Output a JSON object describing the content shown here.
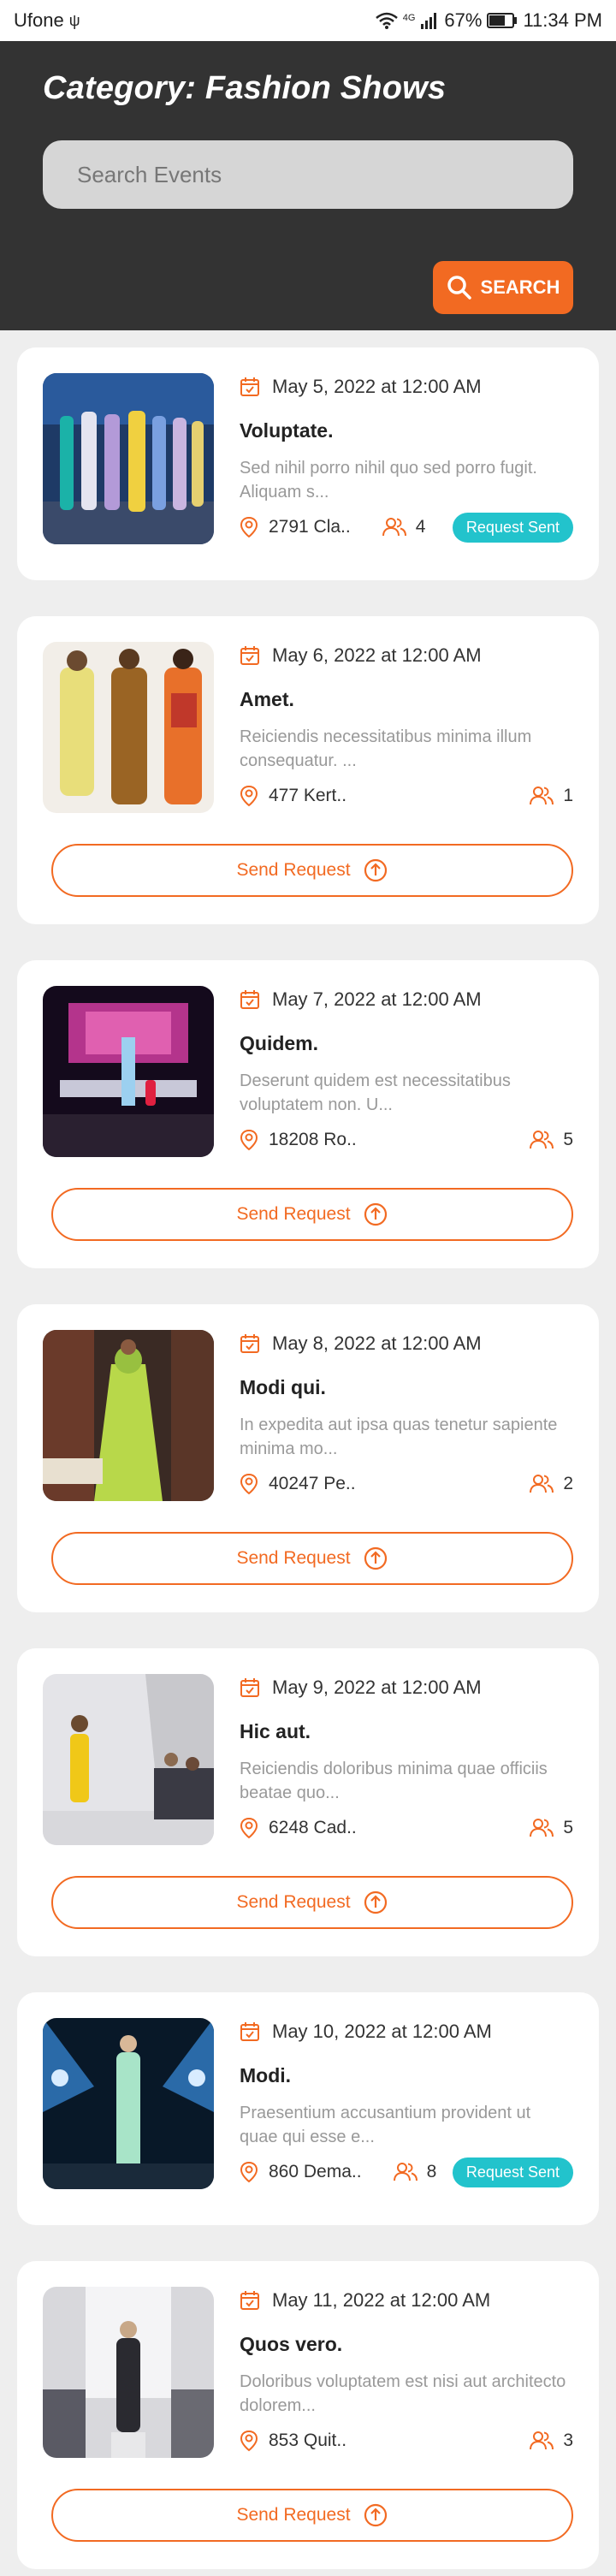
{
  "status_bar": {
    "carrier": "Ufone",
    "network": "4G",
    "battery": "67%",
    "time": "11:34 PM"
  },
  "header": {
    "title": "Category: Fashion Shows",
    "search_placeholder": "Search Events",
    "search_button": "SEARCH"
  },
  "colors": {
    "accent": "#f26a22",
    "header_bg": "#333333",
    "badge": "#22c3cc"
  },
  "events": [
    {
      "date": "May 5, 2022 at 12:00 AM",
      "title": "Voluptate.",
      "description": "Sed nihil porro nihil quo sed porro fugit. Aliquam s...",
      "location": "2791 Cla..",
      "attendees": "4",
      "status": "Request Sent",
      "action": ""
    },
    {
      "date": "May 6, 2022 at 12:00 AM",
      "title": "Amet.",
      "description": "Reiciendis necessitatibus minima illum consequatur. ...",
      "location": "477 Kert..",
      "attendees": "1",
      "status": "",
      "action": "Send Request"
    },
    {
      "date": "May 7, 2022 at 12:00 AM",
      "title": "Quidem.",
      "description": "Deserunt quidem est necessitatibus voluptatem non. U...",
      "location": "18208 Ro..",
      "attendees": "5",
      "status": "",
      "action": "Send Request"
    },
    {
      "date": "May 8, 2022 at 12:00 AM",
      "title": "Modi qui.",
      "description": "In expedita aut ipsa quas tenetur sapiente minima mo...",
      "location": "40247 Pe..",
      "attendees": "2",
      "status": "",
      "action": "Send Request"
    },
    {
      "date": "May 9, 2022 at 12:00 AM",
      "title": "Hic aut.",
      "description": "Reiciendis doloribus minima quae officiis beatae quo...",
      "location": "6248 Cad..",
      "attendees": "5",
      "status": "",
      "action": "Send Request"
    },
    {
      "date": "May 10, 2022 at 12:00 AM",
      "title": "Modi.",
      "description": "Praesentium accusantium provident ut quae qui esse e...",
      "location": "860 Dema..",
      "attendees": "8",
      "status": "Request Sent",
      "action": ""
    },
    {
      "date": "May 11, 2022 at 12:00 AM",
      "title": "Quos vero.",
      "description": "Doloribus voluptatem est nisi aut architecto dolorem...",
      "location": "853 Quit..",
      "attendees": "3",
      "status": "",
      "action": "Send Request"
    }
  ]
}
